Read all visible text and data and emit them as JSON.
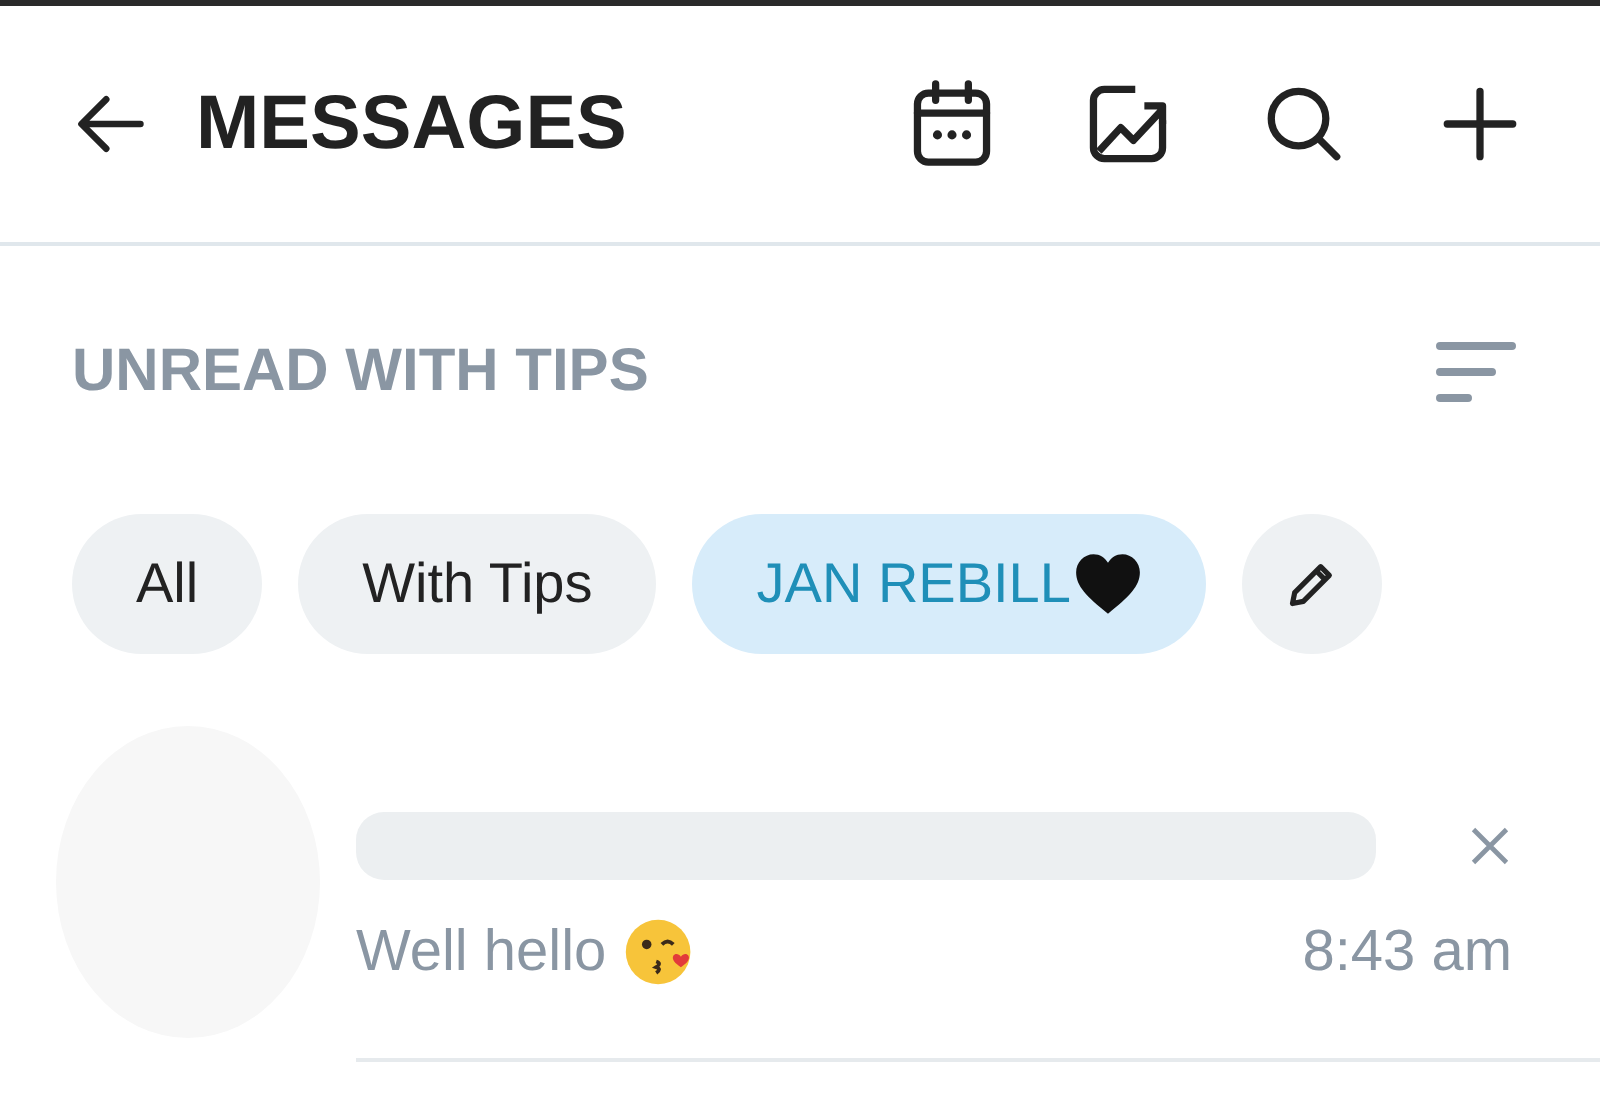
{
  "header": {
    "title": "MESSAGES"
  },
  "section": {
    "title": "UNREAD WITH TIPS"
  },
  "filters": [
    {
      "label": "All",
      "selected": false,
      "heart": false
    },
    {
      "label": "With Tips",
      "selected": false,
      "heart": false
    },
    {
      "label": "JAN REBILL",
      "selected": true,
      "heart": true
    }
  ],
  "messages": [
    {
      "preview": "Well hello",
      "time": "8:43 am",
      "emoji": true
    }
  ]
}
